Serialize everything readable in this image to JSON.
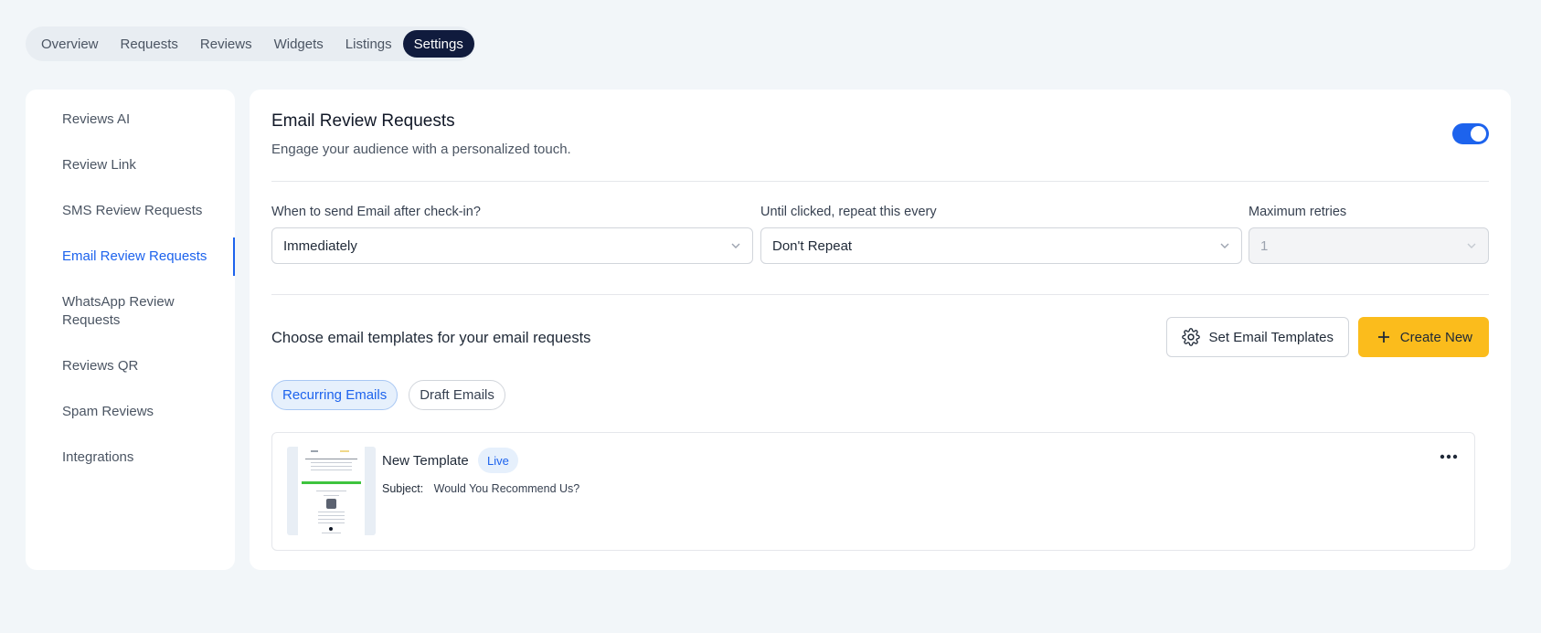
{
  "top_tabs": [
    {
      "label": "Overview"
    },
    {
      "label": "Requests"
    },
    {
      "label": "Reviews"
    },
    {
      "label": "Widgets"
    },
    {
      "label": "Listings"
    },
    {
      "label": "Settings",
      "active": true
    }
  ],
  "sidebar": {
    "items": [
      {
        "label": "Reviews AI"
      },
      {
        "label": "Review Link"
      },
      {
        "label": "SMS Review Requests"
      },
      {
        "label": "Email Review Requests",
        "active": true
      },
      {
        "label": "WhatsApp Review Requests"
      },
      {
        "label": "Reviews QR"
      },
      {
        "label": "Spam Reviews"
      },
      {
        "label": "Integrations"
      }
    ]
  },
  "section": {
    "title": "Email Review Requests",
    "subtitle": "Engage your audience with a personalized touch.",
    "enabled": true
  },
  "fields": {
    "send_after": {
      "label": "When to send Email after check-in?",
      "value": "Immediately"
    },
    "repeat": {
      "label": "Until clicked, repeat this every",
      "value": "Don't Repeat"
    },
    "max_retries": {
      "label": "Maximum retries",
      "value": "1",
      "disabled": true
    }
  },
  "templates": {
    "heading": "Choose email templates for your email requests",
    "set_button": "Set Email Templates",
    "create_button": "Create New",
    "tabs": [
      {
        "label": "Recurring Emails",
        "active": true
      },
      {
        "label": "Draft Emails"
      }
    ],
    "items": [
      {
        "name": "New Template",
        "status": "Live",
        "subject_label": "Subject:",
        "subject": "Would You Recommend Us?"
      }
    ]
  },
  "colors": {
    "accent": "#1d63ed",
    "primary_button": "#fbbc1c",
    "active_tab": "#101b3d",
    "thumb_green_bar": "#3ec43e"
  }
}
